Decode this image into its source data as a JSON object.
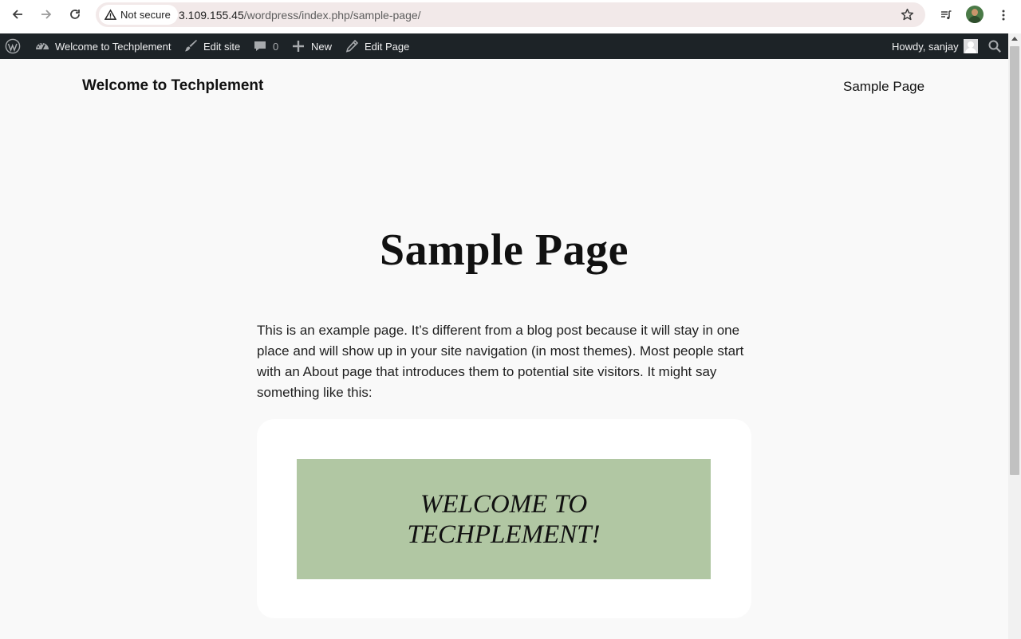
{
  "browser": {
    "security_label": "Not secure",
    "url_host": "3.109.155.45",
    "url_path": "/wordpress/index.php/sample-page/"
  },
  "admin_bar": {
    "site_name": "Welcome to Techplement",
    "edit_site": "Edit site",
    "comments_count": "0",
    "new_label": "New",
    "edit_page": "Edit Page",
    "howdy": "Howdy, sanjay"
  },
  "site": {
    "title": "Welcome to Techplement",
    "nav_item": "Sample Page"
  },
  "page": {
    "title": "Sample Page",
    "body": "This is an example page. It’s different from a blog post because it will stay in one place and will show up in your site navigation (in most themes). Most people start with an About page that introduces them to potential site visitors. It might say something like this:",
    "banner_line1": "WELCOME TO",
    "banner_line2": "TECHPLEMENT!"
  },
  "colors": {
    "admin_bar_bg": "#1d2327",
    "omnibox_bg": "#f2e9e9",
    "page_bg": "#f9f9f9",
    "banner_bg": "#b1c7a3"
  },
  "icons": [
    "back-icon",
    "forward-icon",
    "reload-icon",
    "warning-icon",
    "star-icon",
    "media-controls-icon",
    "profile-avatar",
    "more-icon",
    "wordpress-logo-icon",
    "dashboard-icon",
    "brush-icon",
    "comment-icon",
    "plus-icon",
    "pencil-icon",
    "user-avatar-icon",
    "search-icon"
  ]
}
